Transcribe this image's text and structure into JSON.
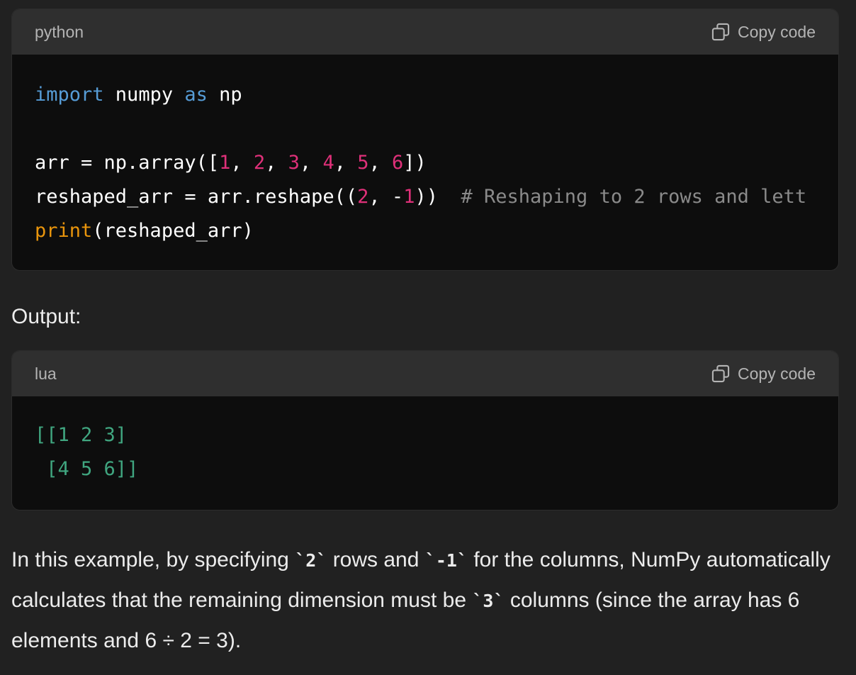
{
  "code_block_1": {
    "language": "python",
    "copy_label": "Copy code",
    "lines": [
      [
        {
          "t": "import",
          "c": "kw"
        },
        {
          "t": " numpy ",
          "c": ""
        },
        {
          "t": "as",
          "c": "kw"
        },
        {
          "t": " np",
          "c": ""
        }
      ],
      [],
      [
        {
          "t": "arr = np.array([",
          "c": ""
        },
        {
          "t": "1",
          "c": "num"
        },
        {
          "t": ", ",
          "c": ""
        },
        {
          "t": "2",
          "c": "num"
        },
        {
          "t": ", ",
          "c": ""
        },
        {
          "t": "3",
          "c": "num"
        },
        {
          "t": ", ",
          "c": ""
        },
        {
          "t": "4",
          "c": "num"
        },
        {
          "t": ", ",
          "c": ""
        },
        {
          "t": "5",
          "c": "num"
        },
        {
          "t": ", ",
          "c": ""
        },
        {
          "t": "6",
          "c": "num"
        },
        {
          "t": "])",
          "c": ""
        }
      ],
      [
        {
          "t": "reshaped_arr = arr.reshape((",
          "c": ""
        },
        {
          "t": "2",
          "c": "num"
        },
        {
          "t": ", -",
          "c": ""
        },
        {
          "t": "1",
          "c": "num"
        },
        {
          "t": "))  ",
          "c": ""
        },
        {
          "t": "# Reshaping to 2 rows and lett",
          "c": "cm"
        }
      ],
      [
        {
          "t": "print",
          "c": "fn"
        },
        {
          "t": "(reshaped_arr)",
          "c": ""
        }
      ]
    ]
  },
  "output_label": "Output:",
  "code_block_2": {
    "language": "lua",
    "copy_label": "Copy code",
    "lines": [
      [
        {
          "t": "[[1 2 3]",
          "c": "out"
        }
      ],
      [
        {
          "t": " [4 5 6]]",
          "c": "out"
        }
      ]
    ]
  },
  "explanation": {
    "part1": "In this example, by specifying ",
    "code1": "`2`",
    "part2": " rows and ",
    "code2": "`-1`",
    "part3": " for the columns, NumPy automatically calculates that the remaining dimension must be ",
    "code3": "`3`",
    "part4": " columns (since the array has 6 elements and 6 ÷ 2 = 3)."
  },
  "icons": {
    "copy": "copy-icon"
  },
  "colors": {
    "background": "#212121",
    "code_background": "#0d0d0d",
    "header_background": "#2f2f2f",
    "keyword": "#569cd6",
    "number": "#df3079",
    "comment": "#8a8a8a",
    "builtin": "#e9950c",
    "output": "#40a680"
  }
}
